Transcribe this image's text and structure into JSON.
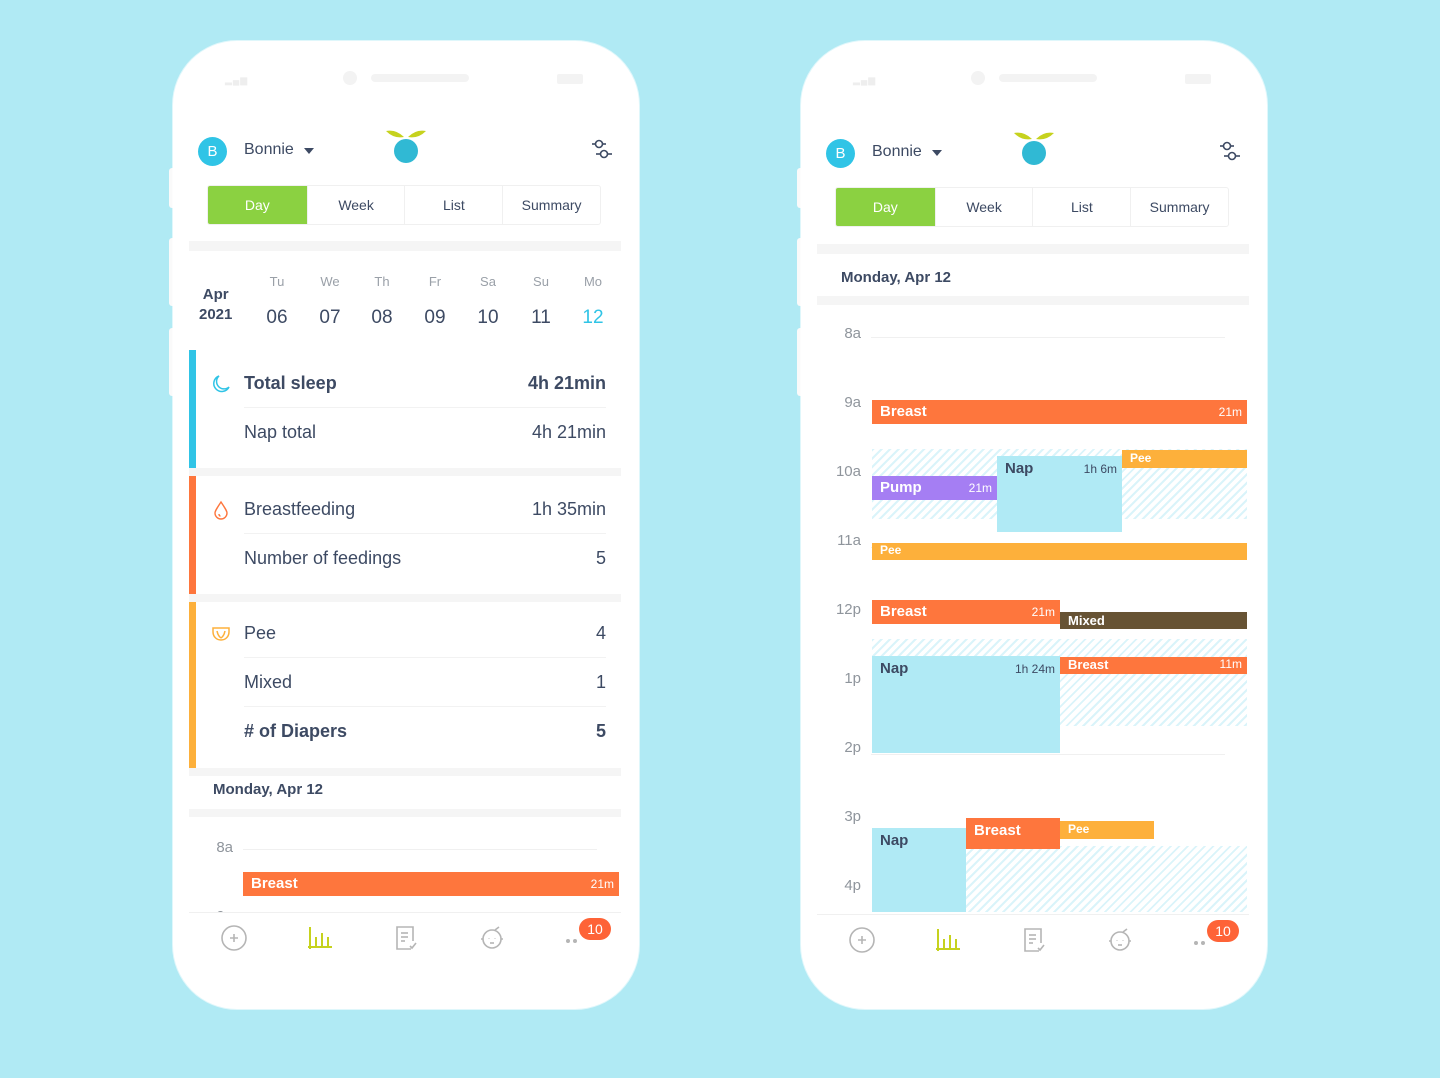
{
  "colors": {
    "background": "#b0eaf4",
    "accent_green": "#8bd141",
    "sleep": "#30c4e6",
    "feeding": "#fe763d",
    "diaper": "#fdb03b",
    "pump": "#a57ef3",
    "mixed": "#675334",
    "nap_block": "#b0eaf5",
    "badge": "#fe6337"
  },
  "header": {
    "avatar_initial": "B",
    "baby_name": "Bonnie",
    "logo_icon": "sprout-logo-icon",
    "filter_icon": "sliders-icon"
  },
  "tabs": [
    {
      "label": "Day",
      "active": true
    },
    {
      "label": "Week",
      "active": false
    },
    {
      "label": "List",
      "active": false
    },
    {
      "label": "Summary",
      "active": false
    }
  ],
  "date_strip": {
    "month": "Apr",
    "year": "2021",
    "days": [
      {
        "dow": "Tu",
        "num": "06"
      },
      {
        "dow": "We",
        "num": "07"
      },
      {
        "dow": "Th",
        "num": "08"
      },
      {
        "dow": "Fr",
        "num": "09"
      },
      {
        "dow": "Sa",
        "num": "10"
      },
      {
        "dow": "Su",
        "num": "11"
      },
      {
        "dow": "Mo",
        "num": "12",
        "selected": true
      }
    ]
  },
  "summary": {
    "sleep": {
      "icon": "moon-icon",
      "rows": [
        {
          "label": "Total sleep",
          "value": "4h 21min",
          "bold": true
        },
        {
          "label": "Nap total",
          "value": "4h 21min"
        }
      ]
    },
    "feeding": {
      "icon": "drop-icon",
      "rows": [
        {
          "label": "Breastfeeding",
          "value": "1h 35min"
        },
        {
          "label": "Number of feedings",
          "value": "5"
        }
      ]
    },
    "diapers": {
      "icon": "diaper-icon",
      "rows": [
        {
          "label": "Pee",
          "value": "4"
        },
        {
          "label": "Mixed",
          "value": "1"
        },
        {
          "label": "# of Diapers",
          "value": "5",
          "bold": true
        }
      ]
    }
  },
  "day_title": "Monday, Apr 12",
  "timeline": {
    "hours": [
      "8a",
      "9a",
      "10a",
      "11a",
      "12p",
      "1p",
      "2p",
      "3p",
      "4p"
    ],
    "events": [
      {
        "type": "breast",
        "label": "Breast",
        "duration": "21m"
      },
      {
        "type": "pee",
        "label": "Pee",
        "duration": ""
      },
      {
        "type": "pump",
        "label": "Pump",
        "duration": "21m"
      },
      {
        "type": "nap",
        "label": "Nap",
        "duration": "1h 6m"
      },
      {
        "type": "pee",
        "label": "Pee",
        "duration": ""
      },
      {
        "type": "breast",
        "label": "Breast",
        "duration": "21m"
      },
      {
        "type": "mixed",
        "label": "Mixed",
        "duration": ""
      },
      {
        "type": "nap",
        "label": "Nap",
        "duration": "1h 24m"
      },
      {
        "type": "breast",
        "label": "Breast",
        "duration": "11m"
      },
      {
        "type": "nap",
        "label": "Nap",
        "duration": ""
      },
      {
        "type": "breast",
        "label": "Breast",
        "duration": ""
      },
      {
        "type": "pee",
        "label": "Pee",
        "duration": ""
      }
    ]
  },
  "bottom_nav": {
    "items": [
      {
        "name": "add",
        "icon": "plus-circle-icon"
      },
      {
        "name": "stats",
        "icon": "bar-chart-icon",
        "active": true
      },
      {
        "name": "log",
        "icon": "checklist-icon"
      },
      {
        "name": "baby",
        "icon": "baby-face-icon"
      },
      {
        "name": "more",
        "icon": "more-dots-icon"
      }
    ],
    "badge_count": "10"
  }
}
